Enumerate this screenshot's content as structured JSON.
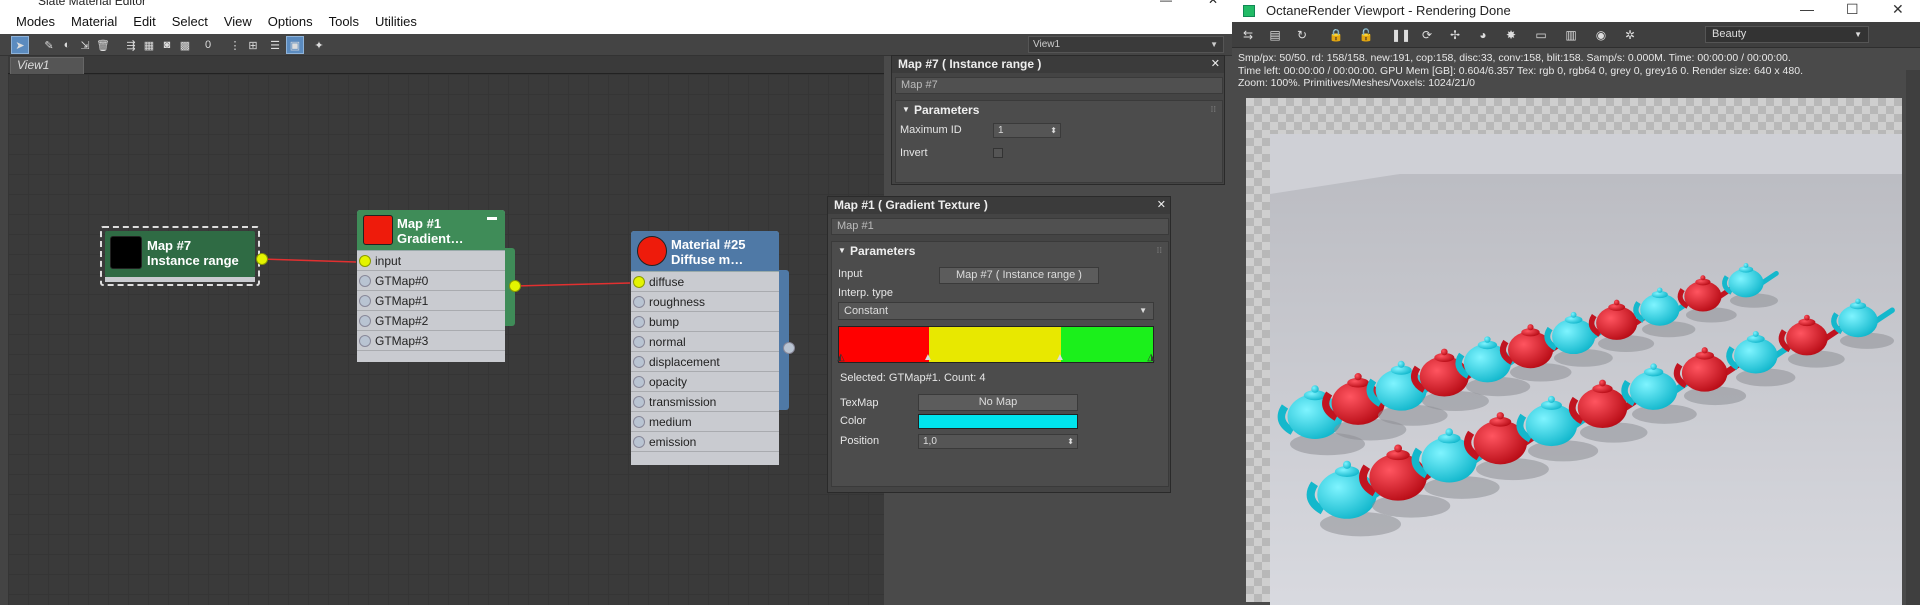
{
  "slate": {
    "title": "Slate Material Editor",
    "menu": [
      "Modes",
      "Material",
      "Edit",
      "Select",
      "View",
      "Options",
      "Tools",
      "Utilities"
    ],
    "view_dropdown": "View1",
    "tab": "View1",
    "nodes": {
      "map7": {
        "title1": "Map #7",
        "title2": "Instance range",
        "swatch": "#000000",
        "head_color": "#2f6b44"
      },
      "map1": {
        "title1": "Map #1",
        "title2": "Gradient…",
        "swatch": "#ee1b0b",
        "head_color": "#3f8c58",
        "slots": [
          "input",
          "GTMap#0",
          "GTMap#1",
          "GTMap#2",
          "GTMap#3"
        ]
      },
      "mat25": {
        "title1": "Material #25",
        "title2": "Diffuse m…",
        "swatch": "#ee1b0b",
        "head_color": "#4f79a6",
        "slots": [
          "diffuse",
          "roughness",
          "bump",
          "normal",
          "displacement",
          "opacity",
          "transmission",
          "medium",
          "emission"
        ]
      }
    }
  },
  "panel_map7": {
    "title": "Map #7  ( Instance range )",
    "name": "Map #7",
    "rollout": "Parameters",
    "max_id_label": "Maximum ID",
    "max_id_value": "1",
    "invert_label": "Invert"
  },
  "panel_map1": {
    "title": "Map #1  ( Gradient Texture )",
    "name": "Map #1",
    "rollout": "Parameters",
    "input_label": "Input",
    "input_button": "Map #7  ( Instance range )",
    "interp_label": "Interp. type",
    "interp_value": "Constant",
    "gradient_colors": [
      "#ff0000",
      "#e8e800",
      "#1bf01b"
    ],
    "selected_text": "Selected: GTMap#1. Count: 4",
    "texmap_label": "TexMap",
    "texmap_button": "No Map",
    "color_label": "Color",
    "color_value": "#00e5ee",
    "position_label": "Position",
    "position_value": "1,0"
  },
  "octane": {
    "title": "OctaneRender Viewport - Rendering Done",
    "beauty": "Beauty",
    "stats": [
      "Smp/px: 50/50.   rd: 158/158.   new:191, cop:158, disc:33, conv:158, blit:158.   Samp/s: 0.000M.   Time: 00:00:00 / 00:00:00.",
      "Time left: 00:00:00 / 00:00:00.   GPU Mem [GB]: 0.604/6.357   Tex: rgb 0, rgb64 0, grey 0, grey16 0.   Render size: 640 x 480.",
      "Zoom: 100%.   Primitives/Meshes/Voxels: 1024/21/0"
    ],
    "colors": {
      "cyan": "#2ad4e6",
      "red": "#e0141e"
    }
  }
}
